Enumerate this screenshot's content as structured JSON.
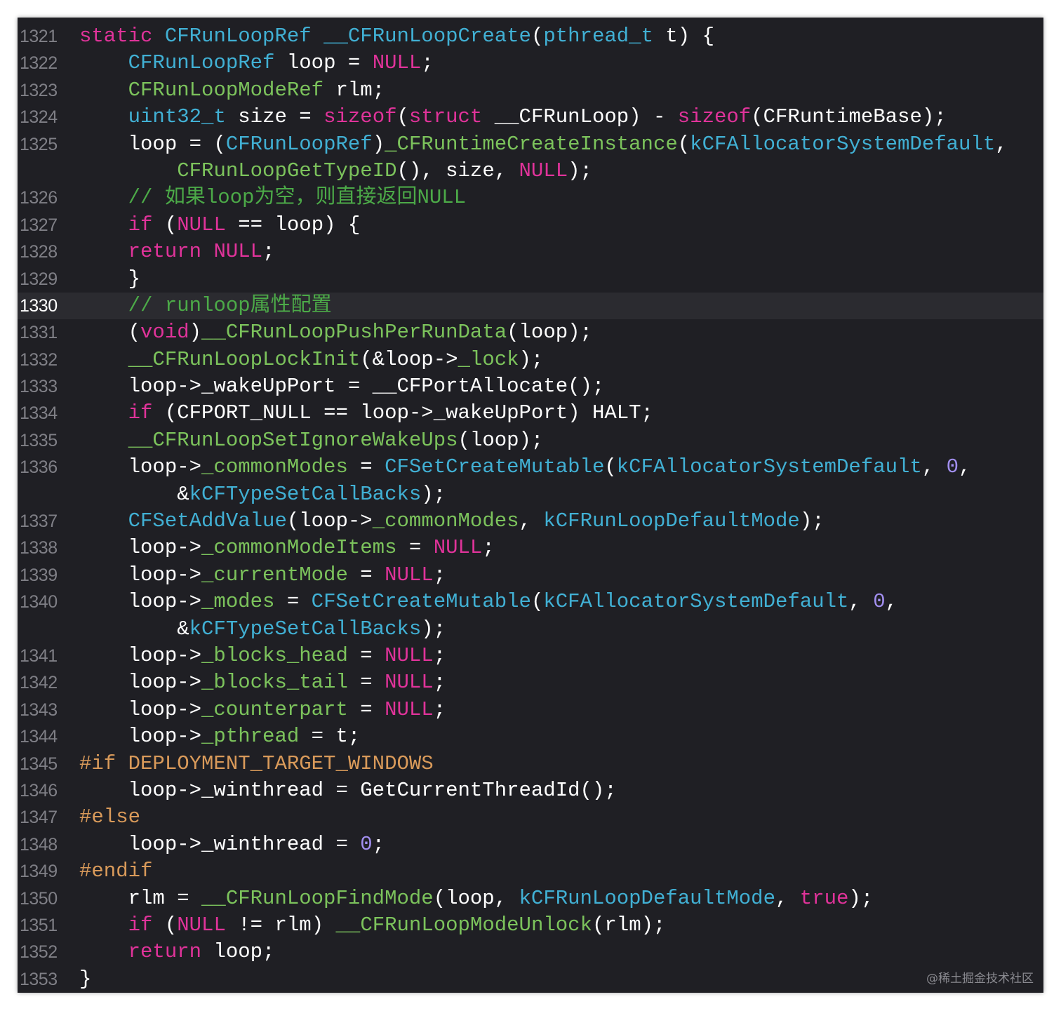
{
  "editor": {
    "current_line": "1330",
    "watermark": "@稀土掘金技术社区",
    "lines": [
      {
        "n": "1321",
        "t": [
          [
            "k",
            "static"
          ],
          [
            "",
            " "
          ],
          [
            "t",
            "CFRunLoopRef"
          ],
          [
            "",
            " "
          ],
          [
            "t",
            "__CFRunLoopCreate"
          ],
          [
            "",
            "("
          ],
          [
            "t",
            "pthread_t"
          ],
          [
            "",
            " t) {"
          ]
        ]
      },
      {
        "n": "1322",
        "t": [
          [
            "",
            "    "
          ],
          [
            "t",
            "CFRunLoopRef"
          ],
          [
            "",
            " loop = "
          ],
          [
            "k",
            "NULL"
          ],
          [
            "",
            ";"
          ]
        ]
      },
      {
        "n": "1323",
        "t": [
          [
            "",
            "    "
          ],
          [
            "f",
            "CFRunLoopModeRef"
          ],
          [
            "",
            " rlm;"
          ]
        ]
      },
      {
        "n": "1324",
        "t": [
          [
            "",
            "    "
          ],
          [
            "t",
            "uint32_t"
          ],
          [
            "",
            " size = "
          ],
          [
            "k",
            "sizeof"
          ],
          [
            "",
            "("
          ],
          [
            "k",
            "struct"
          ],
          [
            "",
            " __CFRunLoop) - "
          ],
          [
            "k",
            "sizeof"
          ],
          [
            "",
            "(CFRuntimeBase);"
          ]
        ]
      },
      {
        "n": "1325",
        "t": [
          [
            "",
            "    loop = ("
          ],
          [
            "t",
            "CFRunLoopRef"
          ],
          [
            "",
            ")"
          ],
          [
            "f",
            "_CFRuntimeCreateInstance"
          ],
          [
            "",
            "("
          ],
          [
            "t",
            "kCFAllocatorSystemDefault"
          ],
          [
            "",
            ","
          ]
        ]
      },
      {
        "n": "",
        "t": [
          [
            "",
            "        "
          ],
          [
            "f",
            "CFRunLoopGetTypeID"
          ],
          [
            "",
            "(), size, "
          ],
          [
            "k",
            "NULL"
          ],
          [
            "",
            ");"
          ]
        ]
      },
      {
        "n": "1326",
        "t": [
          [
            "",
            "    "
          ],
          [
            "c",
            "// 如果loop为空，则直接返回NULL"
          ]
        ]
      },
      {
        "n": "1327",
        "t": [
          [
            "",
            "    "
          ],
          [
            "k",
            "if"
          ],
          [
            "",
            " ("
          ],
          [
            "k",
            "NULL"
          ],
          [
            "",
            " == loop) {"
          ]
        ]
      },
      {
        "n": "1328",
        "t": [
          [
            "",
            "    "
          ],
          [
            "k",
            "return"
          ],
          [
            "",
            " "
          ],
          [
            "k",
            "NULL"
          ],
          [
            "",
            ";"
          ]
        ]
      },
      {
        "n": "1329",
        "t": [
          [
            "",
            "    }"
          ]
        ]
      },
      {
        "n": "1330",
        "t": [
          [
            "",
            "    "
          ],
          [
            "c",
            "// runloop属性配置"
          ]
        ]
      },
      {
        "n": "1331",
        "t": [
          [
            "",
            "    ("
          ],
          [
            "k",
            "void"
          ],
          [
            "",
            ")"
          ],
          [
            "f",
            "__CFRunLoopPushPerRunData"
          ],
          [
            "",
            "(loop);"
          ]
        ]
      },
      {
        "n": "1332",
        "t": [
          [
            "",
            "    "
          ],
          [
            "f",
            "__CFRunLoopLockInit"
          ],
          [
            "",
            "(&loop->"
          ],
          [
            "f",
            "_lock"
          ],
          [
            "",
            ");"
          ]
        ]
      },
      {
        "n": "1333",
        "t": [
          [
            "",
            "    loop->_wakeUpPort = __CFPortAllocate();"
          ]
        ]
      },
      {
        "n": "1334",
        "t": [
          [
            "",
            "    "
          ],
          [
            "k",
            "if"
          ],
          [
            "",
            " (CFPORT_NULL == loop->_wakeUpPort) HALT;"
          ]
        ]
      },
      {
        "n": "1335",
        "t": [
          [
            "",
            "    "
          ],
          [
            "f",
            "__CFRunLoopSetIgnoreWakeUps"
          ],
          [
            "",
            "(loop);"
          ]
        ]
      },
      {
        "n": "1336",
        "t": [
          [
            "",
            "    loop->"
          ],
          [
            "f",
            "_commonModes"
          ],
          [
            "",
            " = "
          ],
          [
            "t",
            "CFSetCreateMutable"
          ],
          [
            "",
            "("
          ],
          [
            "t",
            "kCFAllocatorSystemDefault"
          ],
          [
            "",
            ", "
          ],
          [
            "n",
            "0"
          ],
          [
            "",
            ","
          ]
        ]
      },
      {
        "n": "",
        "t": [
          [
            "",
            "        &"
          ],
          [
            "t",
            "kCFTypeSetCallBacks"
          ],
          [
            "",
            ");"
          ]
        ]
      },
      {
        "n": "1337",
        "t": [
          [
            "",
            "    "
          ],
          [
            "t",
            "CFSetAddValue"
          ],
          [
            "",
            "(loop->"
          ],
          [
            "f",
            "_commonModes"
          ],
          [
            "",
            ", "
          ],
          [
            "t",
            "kCFRunLoopDefaultMode"
          ],
          [
            "",
            ");"
          ]
        ]
      },
      {
        "n": "1338",
        "t": [
          [
            "",
            "    loop->"
          ],
          [
            "f",
            "_commonModeItems"
          ],
          [
            "",
            " = "
          ],
          [
            "k",
            "NULL"
          ],
          [
            "",
            ";"
          ]
        ]
      },
      {
        "n": "1339",
        "t": [
          [
            "",
            "    loop->"
          ],
          [
            "f",
            "_currentMode"
          ],
          [
            "",
            " = "
          ],
          [
            "k",
            "NULL"
          ],
          [
            "",
            ";"
          ]
        ]
      },
      {
        "n": "1340",
        "t": [
          [
            "",
            "    loop->"
          ],
          [
            "f",
            "_modes"
          ],
          [
            "",
            " = "
          ],
          [
            "t",
            "CFSetCreateMutable"
          ],
          [
            "",
            "("
          ],
          [
            "t",
            "kCFAllocatorSystemDefault"
          ],
          [
            "",
            ", "
          ],
          [
            "n",
            "0"
          ],
          [
            "",
            ","
          ]
        ]
      },
      {
        "n": "",
        "t": [
          [
            "",
            "        &"
          ],
          [
            "t",
            "kCFTypeSetCallBacks"
          ],
          [
            "",
            ");"
          ]
        ]
      },
      {
        "n": "1341",
        "t": [
          [
            "",
            "    loop->"
          ],
          [
            "f",
            "_blocks_head"
          ],
          [
            "",
            " = "
          ],
          [
            "k",
            "NULL"
          ],
          [
            "",
            ";"
          ]
        ]
      },
      {
        "n": "1342",
        "t": [
          [
            "",
            "    loop->"
          ],
          [
            "f",
            "_blocks_tail"
          ],
          [
            "",
            " = "
          ],
          [
            "k",
            "NULL"
          ],
          [
            "",
            ";"
          ]
        ]
      },
      {
        "n": "1343",
        "t": [
          [
            "",
            "    loop->"
          ],
          [
            "f",
            "_counterpart"
          ],
          [
            "",
            " = "
          ],
          [
            "k",
            "NULL"
          ],
          [
            "",
            ";"
          ]
        ]
      },
      {
        "n": "1344",
        "t": [
          [
            "",
            "    loop->"
          ],
          [
            "f",
            "_pthread"
          ],
          [
            "",
            " = t;"
          ]
        ]
      },
      {
        "n": "1345",
        "t": [
          [
            "p",
            "#if DEPLOYMENT_TARGET_WINDOWS"
          ]
        ]
      },
      {
        "n": "1346",
        "t": [
          [
            "",
            "    loop->_winthread = GetCurrentThreadId();"
          ]
        ]
      },
      {
        "n": "1347",
        "t": [
          [
            "p",
            "#else"
          ]
        ]
      },
      {
        "n": "1348",
        "t": [
          [
            "",
            "    loop->_winthread = "
          ],
          [
            "n",
            "0"
          ],
          [
            "",
            ";"
          ]
        ]
      },
      {
        "n": "1349",
        "t": [
          [
            "p",
            "#endif"
          ]
        ]
      },
      {
        "n": "1350",
        "t": [
          [
            "",
            "    rlm = "
          ],
          [
            "f",
            "__CFRunLoopFindMode"
          ],
          [
            "",
            "(loop, "
          ],
          [
            "t",
            "kCFRunLoopDefaultMode"
          ],
          [
            "",
            ", "
          ],
          [
            "k",
            "true"
          ],
          [
            "",
            ");"
          ]
        ]
      },
      {
        "n": "1351",
        "t": [
          [
            "",
            "    "
          ],
          [
            "k",
            "if"
          ],
          [
            "",
            " ("
          ],
          [
            "k",
            "NULL"
          ],
          [
            "",
            " != rlm) "
          ],
          [
            "f",
            "__CFRunLoopModeUnlock"
          ],
          [
            "",
            "(rlm);"
          ]
        ]
      },
      {
        "n": "1352",
        "t": [
          [
            "",
            "    "
          ],
          [
            "k",
            "return"
          ],
          [
            "",
            " loop;"
          ]
        ]
      },
      {
        "n": "1353",
        "t": [
          [
            "",
            "}"
          ]
        ]
      }
    ]
  }
}
